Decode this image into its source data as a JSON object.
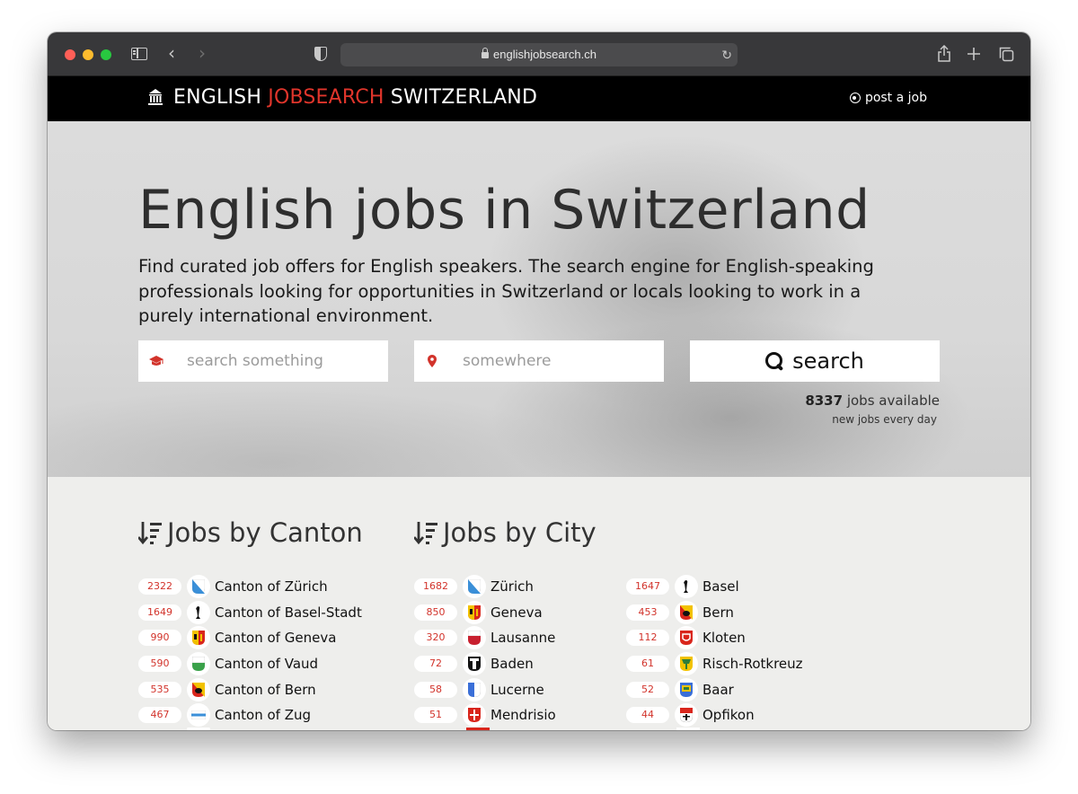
{
  "browser": {
    "url": "englishjobsearch.ch"
  },
  "header": {
    "brand_part1": "ENGLISH ",
    "brand_part2": "JOBSEARCH",
    "brand_part3": " SWITZERLAND",
    "post_job": "post a job"
  },
  "hero": {
    "title": "English jobs in Switzerland",
    "subtitle": "Find curated job offers for English speakers. The search engine for English-speaking professionals looking for opportunities in Switzerland or locals looking to work in a purely international environment.",
    "what_placeholder": "search something",
    "where_placeholder": "somewhere",
    "search_label": "search",
    "jobs_count": "8337",
    "jobs_available": " jobs available",
    "jobs_new": "new jobs every day"
  },
  "colors": {
    "accent": "#e0352b",
    "header_bg": "#000000",
    "page_bg": "#eeeeec"
  },
  "canton_section": {
    "title": "Jobs by Canton",
    "items": [
      {
        "count": "2322",
        "name": "Canton of Zürich",
        "icon": "zurich-flag-icon"
      },
      {
        "count": "1649",
        "name": "Canton of Basel-Stadt",
        "icon": "basel-flag-icon"
      },
      {
        "count": "990",
        "name": "Canton of Geneva",
        "icon": "geneva-flag-icon"
      },
      {
        "count": "590",
        "name": "Canton of Vaud",
        "icon": "vaud-flag-icon"
      },
      {
        "count": "535",
        "name": "Canton of Bern",
        "icon": "bern-flag-icon"
      },
      {
        "count": "467",
        "name": "Canton of Zug",
        "icon": "zug-flag-icon"
      }
    ]
  },
  "city_section": {
    "title": "Jobs by City",
    "col1": [
      {
        "count": "1682",
        "name": "Zürich",
        "icon": "zurich-flag-icon"
      },
      {
        "count": "850",
        "name": "Geneva",
        "icon": "geneva-flag-icon"
      },
      {
        "count": "320",
        "name": "Lausanne",
        "icon": "lausanne-flag-icon"
      },
      {
        "count": "72",
        "name": "Baden",
        "icon": "baden-flag-icon"
      },
      {
        "count": "58",
        "name": "Lucerne",
        "icon": "lucerne-flag-icon"
      },
      {
        "count": "51",
        "name": "Mendrisio",
        "icon": "mendrisio-flag-icon"
      }
    ],
    "col2": [
      {
        "count": "1647",
        "name": "Basel",
        "icon": "basel-flag-icon"
      },
      {
        "count": "453",
        "name": "Bern",
        "icon": "bern-flag-icon"
      },
      {
        "count": "112",
        "name": "Kloten",
        "icon": "kloten-flag-icon"
      },
      {
        "count": "61",
        "name": "Risch-Rotkreuz",
        "icon": "risch-flag-icon"
      },
      {
        "count": "52",
        "name": "Baar",
        "icon": "baar-flag-icon"
      },
      {
        "count": "44",
        "name": "Opfikon",
        "icon": "opfikon-flag-icon"
      }
    ]
  }
}
